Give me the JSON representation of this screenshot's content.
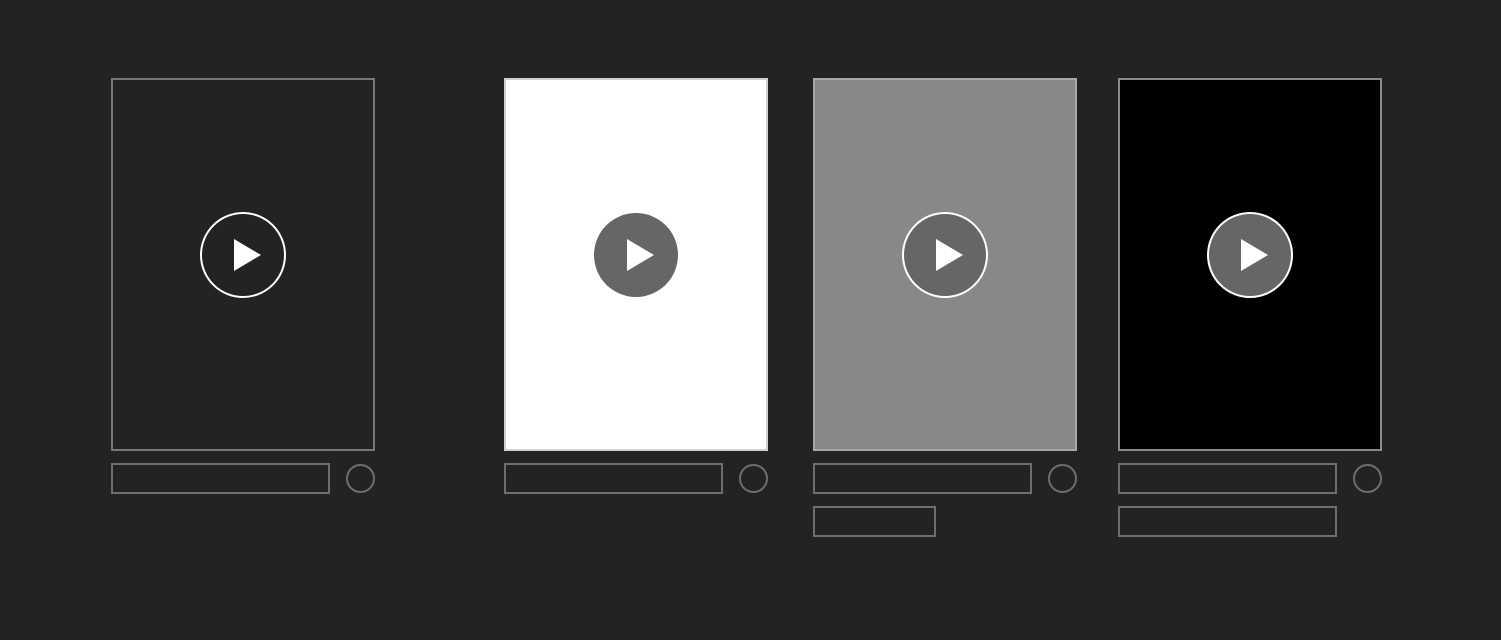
{
  "cards": [
    {
      "variant": "outline",
      "background": "#232323",
      "play_icon": "play-icon",
      "play_style": "outline-white",
      "extra_bar": "none"
    },
    {
      "variant": "light",
      "background": "#ffffff",
      "play_icon": "play-icon",
      "play_style": "filled-gray",
      "extra_bar": "none"
    },
    {
      "variant": "mid",
      "background": "#888888",
      "play_icon": "play-icon",
      "play_style": "filled-gray-outlined",
      "extra_bar": "short"
    },
    {
      "variant": "dark",
      "background": "#000000",
      "play_icon": "play-icon",
      "play_style": "filled-gray-outlined",
      "extra_bar": "long"
    }
  ],
  "colors": {
    "page_background": "#232323",
    "placeholder_border": "#6e6e6e",
    "play_fill": "#666666",
    "play_glyph": "#ffffff"
  }
}
